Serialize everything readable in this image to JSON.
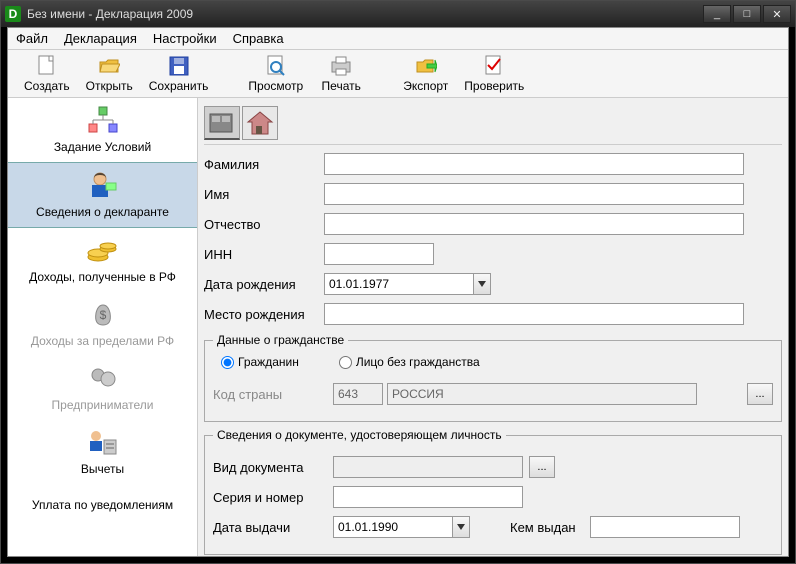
{
  "window": {
    "title": "Без имени - Декларация 2009",
    "icon_letter": "D"
  },
  "menubar": {
    "file": "Файл",
    "declaration": "Декларация",
    "settings": "Настройки",
    "help": "Справка"
  },
  "toolbar": {
    "create": "Создать",
    "open": "Открыть",
    "save": "Сохранить",
    "preview": "Просмотр",
    "print": "Печать",
    "export": "Экспорт",
    "check": "Проверить"
  },
  "sidebar": {
    "items": [
      {
        "label": "Задание Условий"
      },
      {
        "label": "Сведения о декларанте"
      },
      {
        "label": "Доходы, полученные в РФ"
      },
      {
        "label": "Доходы за пределами РФ"
      },
      {
        "label": "Предприниматели"
      },
      {
        "label": "Вычеты"
      },
      {
        "label": "Уплата по уведомлениям"
      }
    ]
  },
  "form": {
    "surname_label": "Фамилия",
    "surname": "",
    "name_label": "Имя",
    "name": "",
    "patronymic_label": "Отчество",
    "patronymic": "",
    "inn_label": "ИНН",
    "inn": "",
    "dob_label": "Дата рождения",
    "dob": "01.01.1977",
    "birthplace_label": "Место рождения",
    "birthplace": "",
    "citizenship_legend": "Данные о гражданстве",
    "citizen_radio": "Гражданин",
    "stateless_radio": "Лицо без гражданства",
    "country_code_label": "Код страны",
    "country_code": "643",
    "country_name": "РОССИЯ",
    "identity_legend": "Сведения о документе, удостоверяющем личность",
    "doc_type_label": "Вид документа",
    "doc_type": "",
    "series_label": "Серия и номер",
    "series": "",
    "issue_date_label": "Дата выдачи",
    "issue_date": "01.01.1990",
    "issued_by_label": "Кем выдан",
    "issued_by": ""
  }
}
